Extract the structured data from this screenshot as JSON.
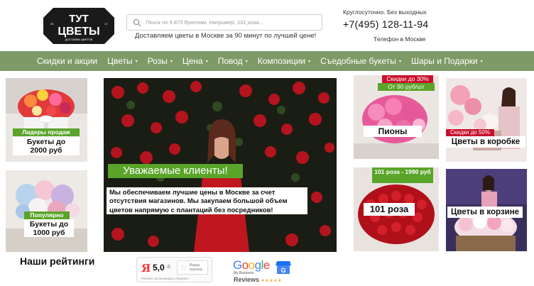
{
  "header": {
    "logo": {
      "top": "ТУТ",
      "main": "ЦВЕТЫ",
      "left_num": "20",
      "right_num": "17",
      "sub": "ДОСТАВКА ЦВЕТОВ"
    },
    "search": {
      "placeholder": "Поиск по 9 873 букетам. Например, 101 роза..."
    },
    "delivery_text": "Доставляем цветы в Москве за 90 минут по лучшей цене!",
    "hours": "Круглосуточно. Без выходных",
    "phone": "+7(495) 128-11-94",
    "phone_sub": "Телефон в Москве"
  },
  "nav": {
    "items": [
      {
        "label": "Скидки и акции",
        "has_caret": false
      },
      {
        "label": "Цветы",
        "has_caret": true
      },
      {
        "label": "Розы",
        "has_caret": true
      },
      {
        "label": "Цена",
        "has_caret": true
      },
      {
        "label": "Повод",
        "has_caret": true
      },
      {
        "label": "Композиции",
        "has_caret": true
      },
      {
        "label": "Съедобные букеты",
        "has_caret": true
      },
      {
        "label": "Шары и Подарки",
        "has_caret": true
      }
    ],
    "caret": "▾"
  },
  "tiles": {
    "bouquets_2000": {
      "badge": "Лидеры продаж",
      "label_line1": "Букеты до",
      "label_line2": "2000 руб"
    },
    "bouquets_1000": {
      "badge": "Популярно",
      "label_line1": "Букеты до",
      "label_line2": "1000 руб"
    },
    "banner": {
      "title": "Уважаемые клиенты!",
      "text": "Мы обеспечиваем лучшие цены в Москве за счет отсутствия магазинов. Мы закупаем большой объем цветов напрямую с плантаций без посредников!"
    },
    "peonies": {
      "badge_red": "Скидки до 30%",
      "badge_green": "От 90 руб/шт",
      "label": "Пионы"
    },
    "flowers_box": {
      "badge_red": "Скидки до 50%",
      "label": "Цветы в коробке"
    },
    "roses_101": {
      "badge": "101 роза - 1990 руб",
      "label": "101 роза"
    },
    "flowers_basket": {
      "label": "Цветы в корзине"
    }
  },
  "ratings": {
    "title": "Наши рейтинги",
    "yandex": {
      "logo": "Я",
      "score": "5,0",
      "max": "/5",
      "vote": "Ваша оценка",
      "footer": "Рейтинг организации в Яндексе"
    },
    "google": {
      "word": "Google",
      "sub": "My Business",
      "reviews": "Reviews",
      "stars": "★★★★★"
    }
  },
  "colors": {
    "nav_bg": "#7e9a66",
    "badge_green": "#5aa42a",
    "badge_red": "#c8102e"
  }
}
